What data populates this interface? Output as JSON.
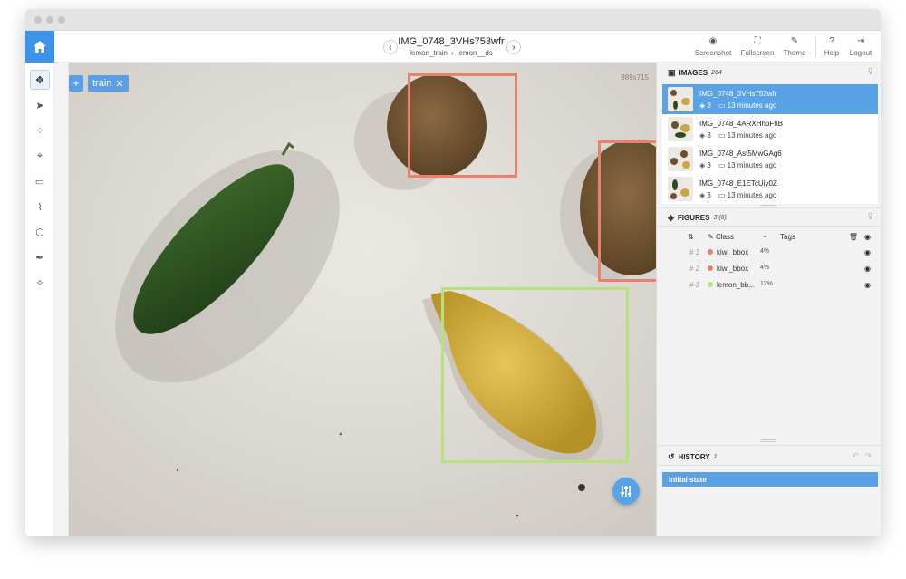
{
  "topbar": {
    "image_name": "IMG_0748_3VHs753wfr",
    "breadcrumb": [
      "lemon_train",
      "lemon__ds"
    ],
    "actions": [
      {
        "label": "Screenshot",
        "icon": "camera-icon"
      },
      {
        "label": "Fullscreen",
        "icon": "fullscreen-icon"
      },
      {
        "label": "Theme",
        "icon": "theme-icon"
      },
      {
        "label": "Help",
        "icon": "help-icon"
      },
      {
        "label": "Logout",
        "icon": "logout-icon"
      }
    ]
  },
  "canvas": {
    "tag_label": "train",
    "image_size": "889x715"
  },
  "images_panel": {
    "title": "IMAGES",
    "count": "264",
    "items": [
      {
        "name": "IMG_0748_3VHs753wfr",
        "figures": "3",
        "time": "13 minutes ago"
      },
      {
        "name": "IMG_0748_4ARXHhpFhB",
        "figures": "3",
        "time": "13 minutes ago"
      },
      {
        "name": "IMG_0748_Ast5MwGAg6",
        "figures": "3",
        "time": "13 minutes ago"
      },
      {
        "name": "IMG_0748_E1ETcUiy0Z",
        "figures": "3",
        "time": "13 minutes ago"
      }
    ]
  },
  "figures_panel": {
    "title": "FIGURES",
    "count": "3 (6)",
    "col_class": "Class",
    "col_tags": "Tags",
    "rows": [
      {
        "idx": "# 1",
        "cls": "kiwi_bbox",
        "pct": "4%",
        "color": "#e8826f"
      },
      {
        "idx": "# 2",
        "cls": "kiwi_bbox",
        "pct": "4%",
        "color": "#e8826f"
      },
      {
        "idx": "# 3",
        "cls": "lemon_bb...",
        "pct": "12%",
        "color": "#b5e27a"
      }
    ]
  },
  "history_panel": {
    "title": "HISTORY",
    "count": "1",
    "initial_state": "Initial state"
  },
  "colors": {
    "accent": "#3d93e8",
    "kiwi": "#e8826f",
    "lemon": "#b5e27a"
  }
}
